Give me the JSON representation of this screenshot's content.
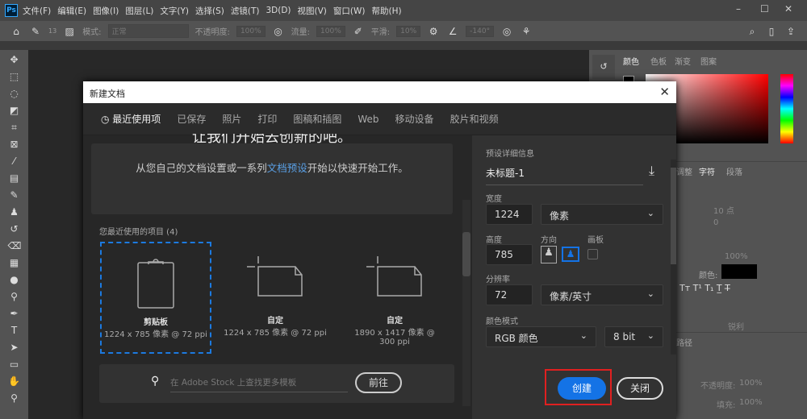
{
  "app": {
    "logo": "Ps",
    "menus": [
      "文件(F)",
      "编辑(E)",
      "图像(I)",
      "图层(L)",
      "文字(Y)",
      "选择(S)",
      "滤镜(T)",
      "3D(D)",
      "视图(V)",
      "窗口(W)",
      "帮助(H)"
    ]
  },
  "options": {
    "brush_size": "13",
    "mode_label": "模式:",
    "mode_value": "正常",
    "opacity_label": "不透明度:",
    "opacity_value": "100%",
    "flow_label": "流量:",
    "flow_value": "100%",
    "smooth_label": "平滑:",
    "smooth_value": "10%",
    "angle_value": "-140°"
  },
  "panels": {
    "color_tabs": [
      "颜色",
      "色板",
      "渐变",
      "图案"
    ],
    "char_tabs": [
      "调整",
      "字符",
      "段落"
    ],
    "size_value": "10 点",
    "tracking_value": "0",
    "scale_value": "100%",
    "color_label": "颜色:",
    "aa_value": "锐利",
    "paths_tab": "路径",
    "layer_opacity_label": "不透明度:",
    "layer_opacity_value": "100%",
    "fill_label": "填充:",
    "fill_value": "100%",
    "accent": "#1473e6"
  },
  "dialog": {
    "title": "新建文档",
    "tabs": [
      "最近使用项",
      "已保存",
      "照片",
      "打印",
      "图稿和插图",
      "Web",
      "移动设备",
      "胶片和视频"
    ],
    "promo_cut": "让我们开始去创新的吧。",
    "promo_a": "从您自己的文档设置或一系列",
    "promo_link": "文档预设",
    "promo_b": "开始以快速开始工作。",
    "recent_title": "您最近使用的项目 (4)",
    "recent": [
      {
        "name": "剪贴板",
        "desc": "1224 x 785 像素 @ 72 ppi"
      },
      {
        "name": "自定",
        "desc": "1224 x 785 像素 @ 72 ppi"
      },
      {
        "name": "自定",
        "desc": "1890 x 1417 像素 @ 300 ppi"
      }
    ],
    "stock_placeholder": "在 Adobe Stock 上查找更多模板",
    "go_label": "前往",
    "preset_title": "预设详细信息",
    "doc_name": "未标题-1",
    "width_label": "宽度",
    "width": "1224",
    "width_unit": "像素",
    "height_label": "高度",
    "height": "785",
    "orient_label": "方向",
    "artboard_label": "画板",
    "res_label": "分辨率",
    "res": "72",
    "res_unit": "像素/英寸",
    "mode_label": "颜色模式",
    "mode": "RGB 颜色",
    "bits": "8 bit",
    "create_label": "创建",
    "close_label": "关闭"
  }
}
